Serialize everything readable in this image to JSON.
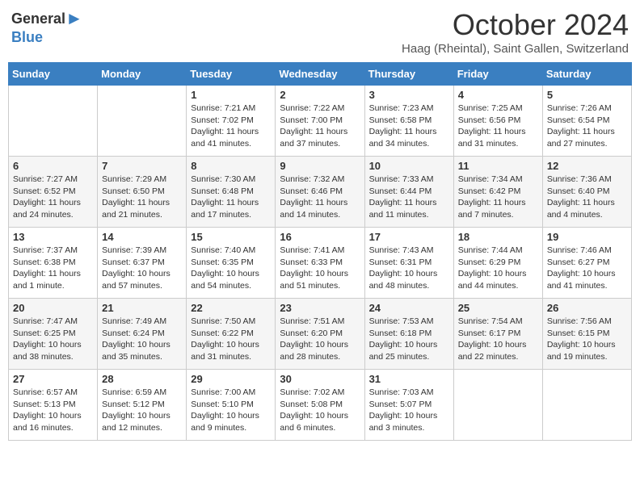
{
  "header": {
    "logo_general": "General",
    "logo_blue": "Blue",
    "month": "October 2024",
    "location": "Haag (Rheintal), Saint Gallen, Switzerland"
  },
  "days_of_week": [
    "Sunday",
    "Monday",
    "Tuesday",
    "Wednesday",
    "Thursday",
    "Friday",
    "Saturday"
  ],
  "weeks": [
    [
      {
        "day": "",
        "content": ""
      },
      {
        "day": "",
        "content": ""
      },
      {
        "day": "1",
        "content": "Sunrise: 7:21 AM\nSunset: 7:02 PM\nDaylight: 11 hours and 41 minutes."
      },
      {
        "day": "2",
        "content": "Sunrise: 7:22 AM\nSunset: 7:00 PM\nDaylight: 11 hours and 37 minutes."
      },
      {
        "day": "3",
        "content": "Sunrise: 7:23 AM\nSunset: 6:58 PM\nDaylight: 11 hours and 34 minutes."
      },
      {
        "day": "4",
        "content": "Sunrise: 7:25 AM\nSunset: 6:56 PM\nDaylight: 11 hours and 31 minutes."
      },
      {
        "day": "5",
        "content": "Sunrise: 7:26 AM\nSunset: 6:54 PM\nDaylight: 11 hours and 27 minutes."
      }
    ],
    [
      {
        "day": "6",
        "content": "Sunrise: 7:27 AM\nSunset: 6:52 PM\nDaylight: 11 hours and 24 minutes."
      },
      {
        "day": "7",
        "content": "Sunrise: 7:29 AM\nSunset: 6:50 PM\nDaylight: 11 hours and 21 minutes."
      },
      {
        "day": "8",
        "content": "Sunrise: 7:30 AM\nSunset: 6:48 PM\nDaylight: 11 hours and 17 minutes."
      },
      {
        "day": "9",
        "content": "Sunrise: 7:32 AM\nSunset: 6:46 PM\nDaylight: 11 hours and 14 minutes."
      },
      {
        "day": "10",
        "content": "Sunrise: 7:33 AM\nSunset: 6:44 PM\nDaylight: 11 hours and 11 minutes."
      },
      {
        "day": "11",
        "content": "Sunrise: 7:34 AM\nSunset: 6:42 PM\nDaylight: 11 hours and 7 minutes."
      },
      {
        "day": "12",
        "content": "Sunrise: 7:36 AM\nSunset: 6:40 PM\nDaylight: 11 hours and 4 minutes."
      }
    ],
    [
      {
        "day": "13",
        "content": "Sunrise: 7:37 AM\nSunset: 6:38 PM\nDaylight: 11 hours and 1 minute."
      },
      {
        "day": "14",
        "content": "Sunrise: 7:39 AM\nSunset: 6:37 PM\nDaylight: 10 hours and 57 minutes."
      },
      {
        "day": "15",
        "content": "Sunrise: 7:40 AM\nSunset: 6:35 PM\nDaylight: 10 hours and 54 minutes."
      },
      {
        "day": "16",
        "content": "Sunrise: 7:41 AM\nSunset: 6:33 PM\nDaylight: 10 hours and 51 minutes."
      },
      {
        "day": "17",
        "content": "Sunrise: 7:43 AM\nSunset: 6:31 PM\nDaylight: 10 hours and 48 minutes."
      },
      {
        "day": "18",
        "content": "Sunrise: 7:44 AM\nSunset: 6:29 PM\nDaylight: 10 hours and 44 minutes."
      },
      {
        "day": "19",
        "content": "Sunrise: 7:46 AM\nSunset: 6:27 PM\nDaylight: 10 hours and 41 minutes."
      }
    ],
    [
      {
        "day": "20",
        "content": "Sunrise: 7:47 AM\nSunset: 6:25 PM\nDaylight: 10 hours and 38 minutes."
      },
      {
        "day": "21",
        "content": "Sunrise: 7:49 AM\nSunset: 6:24 PM\nDaylight: 10 hours and 35 minutes."
      },
      {
        "day": "22",
        "content": "Sunrise: 7:50 AM\nSunset: 6:22 PM\nDaylight: 10 hours and 31 minutes."
      },
      {
        "day": "23",
        "content": "Sunrise: 7:51 AM\nSunset: 6:20 PM\nDaylight: 10 hours and 28 minutes."
      },
      {
        "day": "24",
        "content": "Sunrise: 7:53 AM\nSunset: 6:18 PM\nDaylight: 10 hours and 25 minutes."
      },
      {
        "day": "25",
        "content": "Sunrise: 7:54 AM\nSunset: 6:17 PM\nDaylight: 10 hours and 22 minutes."
      },
      {
        "day": "26",
        "content": "Sunrise: 7:56 AM\nSunset: 6:15 PM\nDaylight: 10 hours and 19 minutes."
      }
    ],
    [
      {
        "day": "27",
        "content": "Sunrise: 6:57 AM\nSunset: 5:13 PM\nDaylight: 10 hours and 16 minutes."
      },
      {
        "day": "28",
        "content": "Sunrise: 6:59 AM\nSunset: 5:12 PM\nDaylight: 10 hours and 12 minutes."
      },
      {
        "day": "29",
        "content": "Sunrise: 7:00 AM\nSunset: 5:10 PM\nDaylight: 10 hours and 9 minutes."
      },
      {
        "day": "30",
        "content": "Sunrise: 7:02 AM\nSunset: 5:08 PM\nDaylight: 10 hours and 6 minutes."
      },
      {
        "day": "31",
        "content": "Sunrise: 7:03 AM\nSunset: 5:07 PM\nDaylight: 10 hours and 3 minutes."
      },
      {
        "day": "",
        "content": ""
      },
      {
        "day": "",
        "content": ""
      }
    ]
  ]
}
